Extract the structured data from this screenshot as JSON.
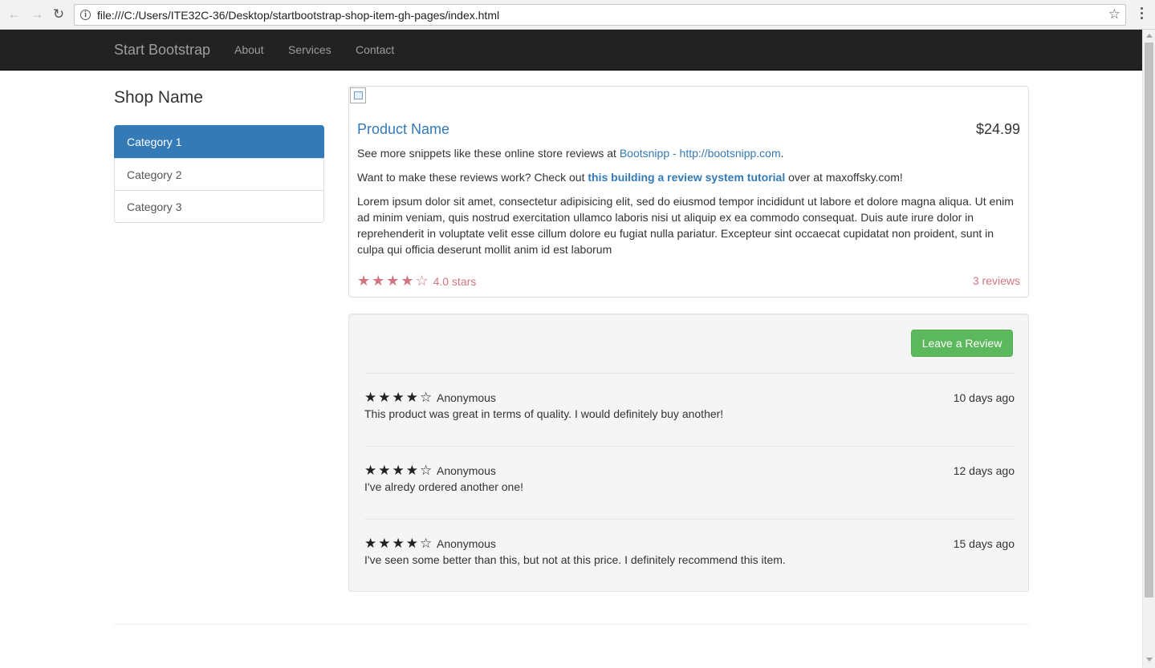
{
  "browser": {
    "back_icon": "←",
    "forward_icon": "→",
    "reload_icon": "↻",
    "info_icon": "i",
    "url": "file:///C:/Users/ITE32C-36/Desktop/startbootstrap-shop-item-gh-pages/index.html",
    "bookmark_icon": "☆"
  },
  "navbar": {
    "brand": "Start Bootstrap",
    "links": [
      "About",
      "Services",
      "Contact"
    ]
  },
  "sidebar": {
    "shop_name": "Shop Name",
    "categories": [
      "Category 1",
      "Category 2",
      "Category 3"
    ],
    "active_index": 0
  },
  "product": {
    "name": "Product Name",
    "price": "$24.99",
    "snippet_prefix": "See more snippets like these online store reviews at ",
    "snippet_link": "Bootsnipp - http://bootsnipp.com",
    "snippet_suffix": ".",
    "tutorial_prefix": "Want to make these reviews work? Check out ",
    "tutorial_link": "this building a review system tutorial",
    "tutorial_suffix": " over at maxoffsky.com!",
    "description": "Lorem ipsum dolor sit amet, consectetur adipisicing elit, sed do eiusmod tempor incididunt ut labore et dolore magna aliqua. Ut enim ad minim veniam, quis nostrud exercitation ullamco laboris nisi ut aliquip ex ea commodo consequat. Duis aute irure dolor in reprehenderit in voluptate velit esse cillum dolore eu fugiat nulla pariatur. Excepteur sint occaecat cupidatat non proident, sunt in culpa qui officia deserunt mollit anim id est laborum",
    "rating_stars": "★★★★☆",
    "rating_value": 4.0,
    "rating_text": "4.0 stars",
    "reviews_count": "3 reviews"
  },
  "reviews_panel": {
    "leave_review_label": "Leave a Review",
    "reviews": [
      {
        "stars": "★★★★☆",
        "rating": 4,
        "author": "Anonymous",
        "date": "10 days ago",
        "text": "This product was great in terms of quality. I would definitely buy another!"
      },
      {
        "stars": "★★★★☆",
        "rating": 4,
        "author": "Anonymous",
        "date": "12 days ago",
        "text": "I've alredy ordered another one!"
      },
      {
        "stars": "★★★★☆",
        "rating": 4,
        "author": "Anonymous",
        "date": "15 days ago",
        "text": "I've seen some better than this, but not at this price. I definitely recommend this item."
      }
    ]
  },
  "colors": {
    "primary": "#337ab7",
    "success": "#5cb85c",
    "rating": "#d17581",
    "navbar_bg": "#222222"
  }
}
